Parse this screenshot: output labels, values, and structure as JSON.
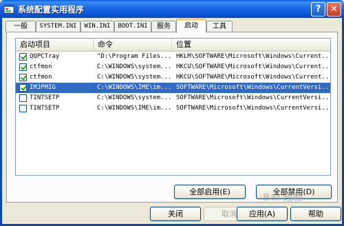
{
  "window": {
    "title": "系统配置实用程序",
    "help_glyph": "?",
    "close_glyph": "✕"
  },
  "tabs": [
    "一般",
    "SYSTEM.INI",
    "WIN.INI",
    "BOOT.INI",
    "服务",
    "启动",
    "工具"
  ],
  "active_tab": "启动",
  "columns": [
    "启动项目",
    "命令",
    "位置"
  ],
  "rows": [
    {
      "checked": true,
      "item": "QQPCTray",
      "command": "\"D:\\Program Files...",
      "location": "HKLM\\SOFTWARE\\Microsoft\\Windows\\Current..."
    },
    {
      "checked": true,
      "item": "ctfmon",
      "command": "C:\\WINDOWS\\system...",
      "location": "HKCU\\SOFTWARE\\Microsoft\\Windows\\Current..."
    },
    {
      "checked": true,
      "item": "ctfmon",
      "command": "C:\\WINDOWS\\system...",
      "location": "HKCU\\SOFTWARE\\Microsoft\\Windows\\Current..."
    },
    {
      "checked": true,
      "item": "IMJPMIG",
      "command": "C:\\WINDOWS\\IME\\im...",
      "location": "SOFTWARE\\Microsoft\\Windows\\CurrentVersi...",
      "selected": true
    },
    {
      "checked": false,
      "item": "TINTSETP",
      "command": "C:\\WINDOWS\\system...",
      "location": "SOFTWARE\\Microsoft\\Windows\\CurrentVersi..."
    },
    {
      "checked": false,
      "item": "TINTSETP",
      "command": "C:\\WINDOWS\\IME\\im...",
      "location": "SOFTWARE\\Microsoft\\Windows\\CurrentVersi..."
    }
  ],
  "buttons": {
    "enable_all": "全部启用(E)",
    "disable_all": "全部禁用(D)",
    "close": "关闭",
    "cancel": "取消",
    "apply": "应用(A)",
    "help": "帮助"
  },
  "watermark": "Bai 经验"
}
